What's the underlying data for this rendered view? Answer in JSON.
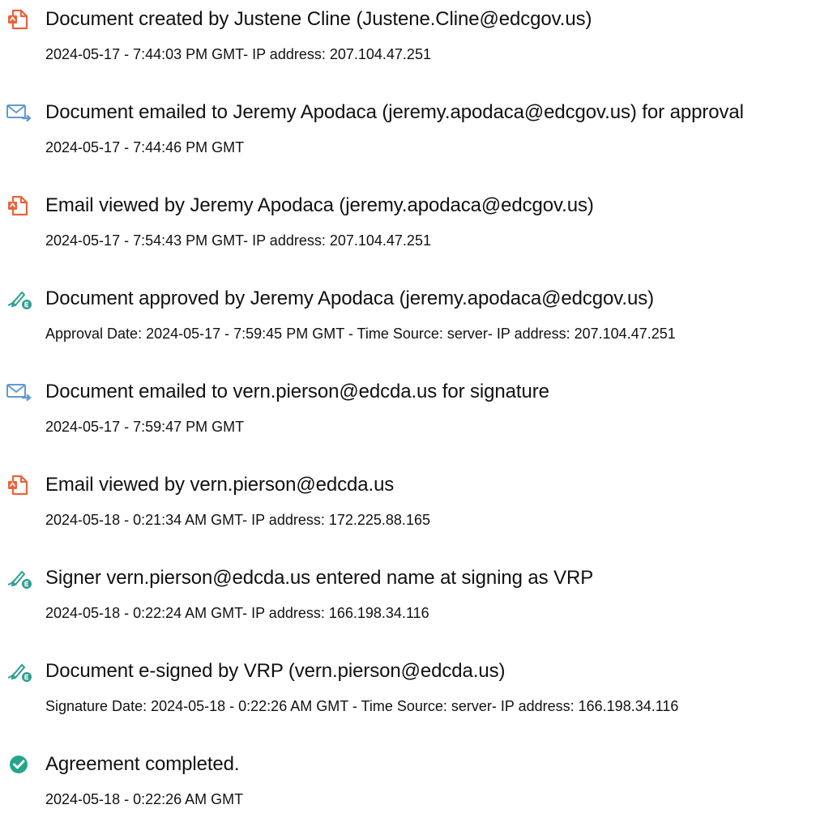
{
  "icons": {
    "document-icon": {
      "color": "#e8633a"
    },
    "email-icon": {
      "color": "#5f9bd0"
    },
    "esign-icon": {
      "color": "#2e9e8f"
    },
    "check-icon": {
      "color": "#26a58a"
    }
  },
  "events": [
    {
      "icon": "document-icon",
      "title": "Document created by Justene Cline (Justene.Cline@edcgov.us)",
      "detail": "2024-05-17 - 7:44:03 PM GMT- IP address: 207.104.47.251"
    },
    {
      "icon": "email-icon",
      "title": "Document emailed to Jeremy Apodaca (jeremy.apodaca@edcgov.us) for approval",
      "detail": "2024-05-17 - 7:44:46 PM GMT"
    },
    {
      "icon": "document-icon",
      "title": "Email viewed by Jeremy Apodaca (jeremy.apodaca@edcgov.us)",
      "detail": "2024-05-17 - 7:54:43 PM GMT- IP address: 207.104.47.251"
    },
    {
      "icon": "esign-icon",
      "title": "Document approved by Jeremy Apodaca (jeremy.apodaca@edcgov.us)",
      "detail": "Approval Date: 2024-05-17 - 7:59:45 PM GMT - Time Source: server- IP address: 207.104.47.251"
    },
    {
      "icon": "email-icon",
      "title": "Document emailed to vern.pierson@edcda.us for signature",
      "detail": "2024-05-17 - 7:59:47 PM GMT"
    },
    {
      "icon": "document-icon",
      "title": "Email viewed by vern.pierson@edcda.us",
      "detail": "2024-05-18 - 0:21:34 AM GMT- IP address: 172.225.88.165"
    },
    {
      "icon": "esign-icon",
      "title": "Signer vern.pierson@edcda.us entered name at signing as VRP",
      "detail": "2024-05-18 - 0:22:24 AM GMT- IP address: 166.198.34.116"
    },
    {
      "icon": "esign-icon",
      "title": "Document e-signed by VRP (vern.pierson@edcda.us)",
      "detail": "Signature Date: 2024-05-18 - 0:22:26 AM GMT - Time Source: server- IP address: 166.198.34.116"
    },
    {
      "icon": "check-icon",
      "title": "Agreement completed.",
      "detail": "2024-05-18 - 0:22:26 AM GMT"
    }
  ]
}
